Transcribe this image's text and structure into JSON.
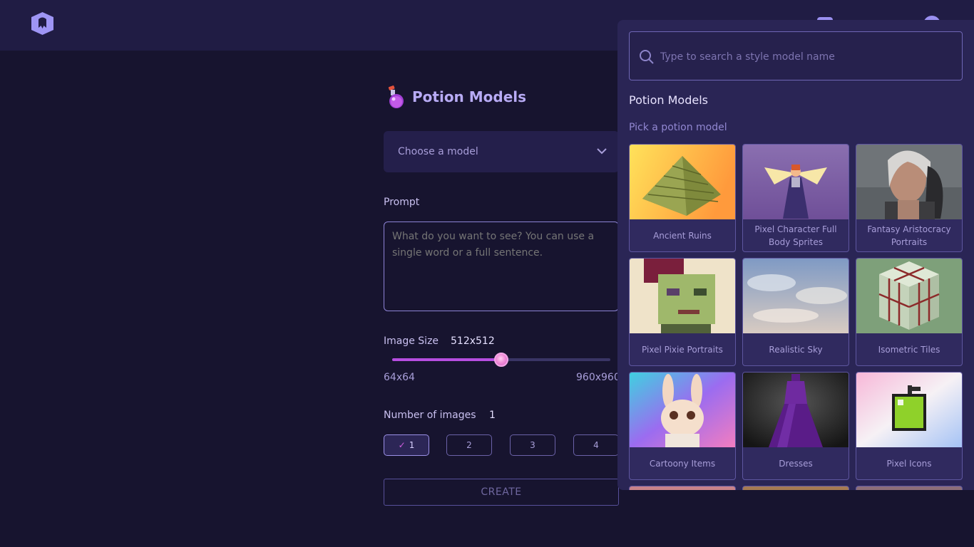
{
  "header": {
    "logo_icon": "app-logo-icon",
    "right_icons": [
      "discord-icon",
      "user-avatar-icon"
    ]
  },
  "main": {
    "title": "Potion Models",
    "title_icon": "potion-bottle-icon",
    "model_select": {
      "placeholder": "Choose a model",
      "icon": "chevron-down-icon"
    },
    "prompt": {
      "label": "Prompt",
      "placeholder": "What do you want to see? You can use a single word or a full sentence."
    },
    "image_size": {
      "label": "Image Size",
      "value": "512x512",
      "min_label": "64x64",
      "max_label": "960x960",
      "slider_fraction": 0.5
    },
    "num_images": {
      "label": "Number of images",
      "value": "1",
      "options": [
        "1",
        "2",
        "3",
        "4"
      ],
      "selected": "1"
    },
    "create_label": "CREATE"
  },
  "panel": {
    "search_placeholder": "Type to search a style model name",
    "title": "Potion Models",
    "subtitle": "Pick a potion model",
    "cards": [
      {
        "label": "Ancient Ruins"
      },
      {
        "label": "Pixel Character Full Body Sprites"
      },
      {
        "label": "Fantasy Aristocracy Portraits"
      },
      {
        "label": "Pixel Pixie Portraits"
      },
      {
        "label": "Realistic Sky"
      },
      {
        "label": "Isometric Tiles"
      },
      {
        "label": "Cartoony Items"
      },
      {
        "label": "Dresses"
      },
      {
        "label": "Pixel Icons"
      }
    ]
  },
  "colors": {
    "background": "#17142f",
    "header": "#201c44",
    "panel": "#2a2555",
    "accent": "#b64de0"
  }
}
